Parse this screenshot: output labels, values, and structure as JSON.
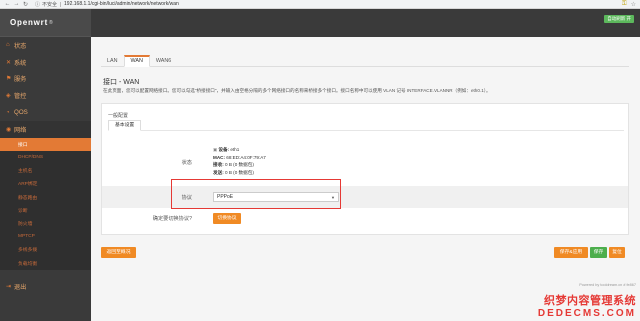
{
  "browser": {
    "insecure_label": "不安全",
    "url": "192.168.1.1/cgi-bin/luci/admin/network/network/wan"
  },
  "sidebar": {
    "brand": "Openwrt",
    "brand_mark": "®",
    "items": [
      {
        "label": "状态",
        "icon": "home-icon"
      },
      {
        "label": "系统",
        "icon": "wrench-icon"
      },
      {
        "label": "服务",
        "icon": "flag-icon"
      },
      {
        "label": "管控",
        "icon": "shield-icon"
      },
      {
        "label": "QOS",
        "icon": "gauge-icon"
      },
      {
        "label": "网络",
        "icon": "globe-icon"
      }
    ],
    "network_sub": [
      "接口",
      "DHCP/DNS",
      "主机名",
      "ARP绑定",
      "静态路由",
      "诊断",
      "防火墙",
      "MPTCP",
      "多线多拨",
      "负载均衡"
    ],
    "logout": "退出"
  },
  "top": {
    "status_badge": "自动刷新 开"
  },
  "tabs": [
    "LAN",
    "WAN",
    "WAN6"
  ],
  "page": {
    "title": "接口 - WAN",
    "desc": "在此页面，您可以配置网络接口。您可以勾选\"桥接接口\"，并输入由空格分隔的多个网络接口的名称来桥接多个接口。接口名称中可以使用 VLAN 记号 INTERFACE.VLANNR（例如：eth0.1）。"
  },
  "config": {
    "heading": "一般配置",
    "inner_tab": "基本设置",
    "status_label": "状态",
    "device_label": "设备:",
    "device_value": "eth1",
    "mac_label": "MAC:",
    "mac_value": "68:ED:A4:0F:79:A7",
    "rx_label": "接收:",
    "rx_value": "0 B (0 数据包)",
    "tx_label": "发送:",
    "tx_value": "0 B (0 数据包)",
    "protocol_label": "协议",
    "protocol_value": "PPPoE",
    "switch_question": "确定要切换协议?",
    "switch_button": "切换协议"
  },
  "actions": {
    "back": "返回至概况",
    "save_apply": "保存&应用",
    "save": "保存",
    "reset": "复位"
  },
  "footer": "Powered by tooldream.cn # fe867",
  "watermark": {
    "cn": "织梦内容管理系统",
    "en": "DEDECMS.COM"
  },
  "colors": {
    "accent": "#e37a35",
    "sidebar_bg": "#3a3a3a",
    "green": "#4cae4c",
    "highlight": "#e53935"
  }
}
